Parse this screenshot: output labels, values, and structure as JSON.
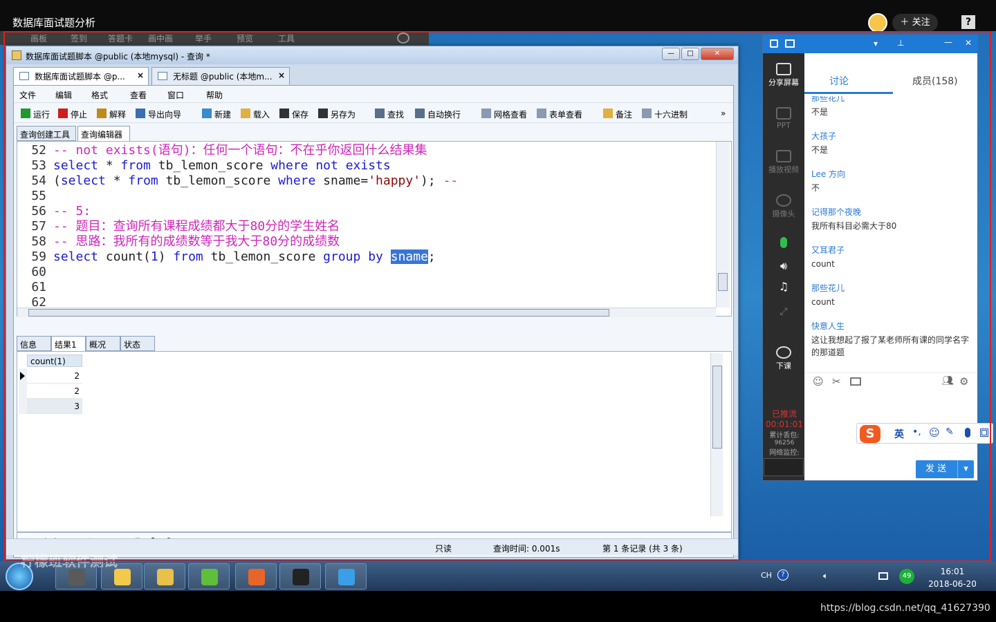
{
  "video": {
    "title": "数据库面试题分析",
    "follow_label": "关注",
    "help_glyph": "?"
  },
  "hidden_toolbar": {
    "items": [
      "画板",
      "签到",
      "答题卡",
      "画中画",
      "举手",
      "预览",
      "工具"
    ]
  },
  "window": {
    "title": "数据库面试题脚本 @public (本地mysql) - 查询 *",
    "minimize_glyph": "—",
    "maximize_glyph": "□",
    "close_glyph": "✕"
  },
  "tabs": [
    {
      "label": "数据库面试题脚本 @p..."
    },
    {
      "label": "无标题 @public (本地m..."
    }
  ],
  "tab_close_glyph": "×",
  "menu": [
    "文件",
    "编辑",
    "格式",
    "查看",
    "窗口",
    "帮助"
  ],
  "toolbar": [
    {
      "label": "运行",
      "color": "#1e9a2e"
    },
    {
      "label": "停止",
      "color": "#d01c1c"
    },
    {
      "label": "解释",
      "color": "#c08a1a"
    },
    {
      "label": "导出向导",
      "color": "#3a6fb0"
    },
    {
      "label": "新建",
      "color": "#3a8ad0"
    },
    {
      "label": "载入",
      "color": "#e0b040"
    },
    {
      "label": "保存",
      "color": "#333333"
    },
    {
      "label": "另存为",
      "color": "#333333"
    },
    {
      "label": "查找",
      "color": "#5a6f8a"
    },
    {
      "label": "自动换行",
      "color": "#5a6f8a"
    },
    {
      "label": "网格查看",
      "color": "#8a9ab0"
    },
    {
      "label": "表单查看",
      "color": "#8a9ab0"
    },
    {
      "label": "备注",
      "color": "#e0b040"
    },
    {
      "label": "十六进制",
      "color": "#8a9ab0"
    }
  ],
  "toolbar_more_glyph": "»",
  "subtabs": [
    "查询创建工具",
    "查询编辑器"
  ],
  "editor": {
    "lines": [
      {
        "n": "52",
        "segments": [
          {
            "t": "-- not exists(语句)：任何一个语句：不在乎你返回什么结果集",
            "c": "cm"
          }
        ]
      },
      {
        "n": "53",
        "segments": [
          {
            "t": "select",
            "c": "kw"
          },
          {
            "t": " * ",
            "c": ""
          },
          {
            "t": "from",
            "c": "kw"
          },
          {
            "t": " tb_lemon_score ",
            "c": ""
          },
          {
            "t": "where",
            "c": "kw"
          },
          {
            "t": " ",
            "c": ""
          },
          {
            "t": "not",
            "c": "kw"
          },
          {
            "t": " ",
            "c": ""
          },
          {
            "t": "exists",
            "c": "kw"
          }
        ]
      },
      {
        "n": "54",
        "segments": [
          {
            "t": "(",
            "c": ""
          },
          {
            "t": "select",
            "c": "kw"
          },
          {
            "t": " * ",
            "c": ""
          },
          {
            "t": "from",
            "c": "kw"
          },
          {
            "t": " tb_lemon_score ",
            "c": ""
          },
          {
            "t": "where",
            "c": "kw"
          },
          {
            "t": " sname=",
            "c": ""
          },
          {
            "t": "'happy'",
            "c": "st"
          },
          {
            "t": "); ",
            "c": ""
          },
          {
            "t": "--",
            "c": "cm"
          }
        ]
      },
      {
        "n": "55",
        "segments": []
      },
      {
        "n": "56",
        "segments": [
          {
            "t": "-- 5:",
            "c": "cm"
          }
        ]
      },
      {
        "n": "57",
        "segments": [
          {
            "t": "-- 题目：查询所有课程成绩都大于80分的学生姓名",
            "c": "cm"
          }
        ]
      },
      {
        "n": "58",
        "segments": [
          {
            "t": "-- 思路：我所有的成绩数等于我大于80分的成绩数",
            "c": "cm"
          }
        ]
      },
      {
        "n": "59",
        "segments": [
          {
            "t": "select",
            "c": "kw"
          },
          {
            "t": " count(",
            "c": ""
          },
          {
            "t": "1",
            "c": "kw"
          },
          {
            "t": ") ",
            "c": ""
          },
          {
            "t": "from",
            "c": "kw"
          },
          {
            "t": " tb_lemon_score ",
            "c": ""
          },
          {
            "t": "group",
            "c": "kw"
          },
          {
            "t": " ",
            "c": ""
          },
          {
            "t": "by",
            "c": "kw"
          },
          {
            "t": " ",
            "c": ""
          },
          {
            "t": "sname",
            "c": "hl"
          },
          {
            "t": ";",
            "c": ""
          }
        ]
      },
      {
        "n": "60",
        "segments": []
      },
      {
        "n": "61",
        "segments": []
      },
      {
        "n": "62",
        "segments": []
      }
    ]
  },
  "result_tabs": [
    "信息",
    "结果1",
    "概况",
    "状态"
  ],
  "result": {
    "column": "count(1)",
    "rows": [
      "2",
      "2",
      "3"
    ]
  },
  "navbar_glyphs": [
    "⏮",
    "◀",
    "▶",
    "⏭",
    "+",
    "−",
    "✓",
    "✗",
    "⟳",
    "⊘"
  ],
  "status": {
    "readonly": "只读",
    "query_time": "查询时间: 0.001s",
    "records": "第 1 条记录 (共 3 条)"
  },
  "chat": {
    "tab_discuss": "讨论",
    "tab_members": "成员(158)",
    "side": [
      {
        "label": "分享屏幕",
        "dim": false
      },
      {
        "label": "PPT",
        "dim": true
      },
      {
        "label": "播放视频",
        "dim": true
      },
      {
        "label": "摄像头",
        "dim": true
      },
      {
        "label": "下课",
        "dim": false
      }
    ],
    "messages": [
      {
        "name": "那些花儿",
        "text": "不是"
      },
      {
        "name": "大孩子",
        "text": "不是"
      },
      {
        "name": "Lee 方向",
        "text": "不"
      },
      {
        "name": "记得那个夜晚",
        "text": "我所有科目必需大于80"
      },
      {
        "name": "又耳君子",
        "text": "count"
      },
      {
        "name": "那些花儿",
        "text": "count"
      },
      {
        "name": "快意人生",
        "text": "这让我想起了报了某老师所有课的同学名字的那道题"
      }
    ],
    "ime_label": "英",
    "send_label": "发 送",
    "send_arrow": "▾",
    "rec_status": "已推流",
    "rec_time": "00:01:01",
    "stat_line1": "累计丢包:",
    "stat_value": "96256",
    "stat_line2": "网络监控:"
  },
  "taskbar": {
    "lang": "CH",
    "badge": "49",
    "time": "16:01",
    "date": "2018-06-20",
    "apps": [
      {
        "color": "#5a5a5a"
      },
      {
        "color": "#f2c94c"
      },
      {
        "color": "#e8c04a"
      },
      {
        "color": "#5fbf3a"
      },
      {
        "color": "#e8652a"
      },
      {
        "color": "#222222"
      },
      {
        "color": "#3a9fe6"
      }
    ]
  },
  "watermark": "https://blog.csdn.net/qq_41627390",
  "brand_watermark": "柠檬班软件测试"
}
